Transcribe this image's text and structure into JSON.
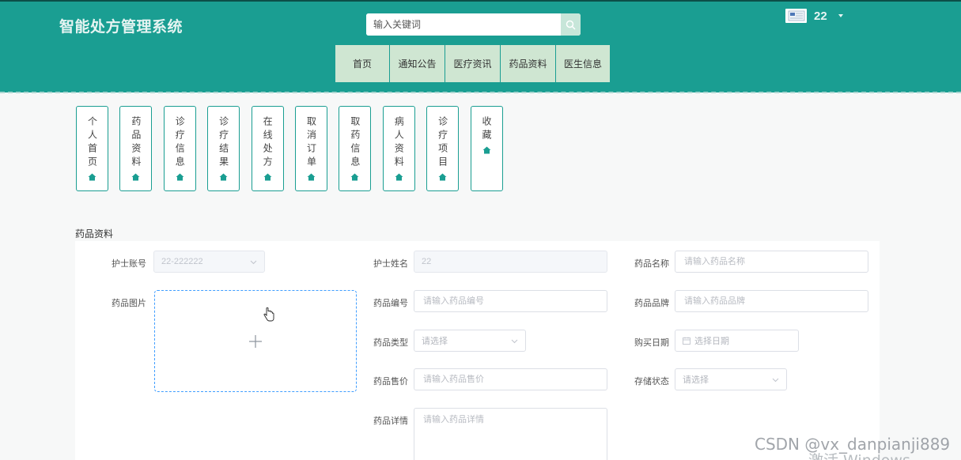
{
  "header": {
    "brand": "智能处方管理系统",
    "search_placeholder": "输入关键词",
    "username": "22"
  },
  "nav": [
    {
      "label": "首页"
    },
    {
      "label": "通知公告"
    },
    {
      "label": "医疗资讯"
    },
    {
      "label": "药品资料"
    },
    {
      "label": "医生信息"
    }
  ],
  "tiles": [
    {
      "label": "个人首页"
    },
    {
      "label": "药品资料"
    },
    {
      "label": "诊疗信息"
    },
    {
      "label": "诊疗结果"
    },
    {
      "label": "在线处方"
    },
    {
      "label": "取消订单"
    },
    {
      "label": "取药信息"
    },
    {
      "label": "病人资料"
    },
    {
      "label": "诊疗项目"
    },
    {
      "label": "收藏"
    }
  ],
  "section_title": "药品资料",
  "form": {
    "nurse_account_label": "护士账号",
    "nurse_account_value": "22-222222",
    "nurse_name_label": "护士姓名",
    "nurse_name_value": "22",
    "drug_name_label": "药品名称",
    "drug_name_placeholder": "请输入药品名称",
    "drug_image_label": "药品图片",
    "drug_code_label": "药品编号",
    "drug_code_placeholder": "请输入药品编号",
    "drug_brand_label": "药品品牌",
    "drug_brand_placeholder": "请输入药品品牌",
    "drug_type_label": "药品类型",
    "drug_type_placeholder": "请选择",
    "purchase_date_label": "购买日期",
    "purchase_date_placeholder": "选择日期",
    "drug_price_label": "药品售价",
    "drug_price_placeholder": "请输入药品售价",
    "storage_label": "存储状态",
    "storage_placeholder": "请选择",
    "drug_detail_label": "药品详情",
    "drug_detail_placeholder": "请输入药品详情"
  },
  "watermark": "CSDN @vx_danpianji889",
  "watermark2": "激活 Windows",
  "colors": {
    "header_bg": "#1a9e92",
    "nav_bg": "#cfe6d2",
    "accent": "#1a9e92",
    "upload_border": "#409eff"
  }
}
